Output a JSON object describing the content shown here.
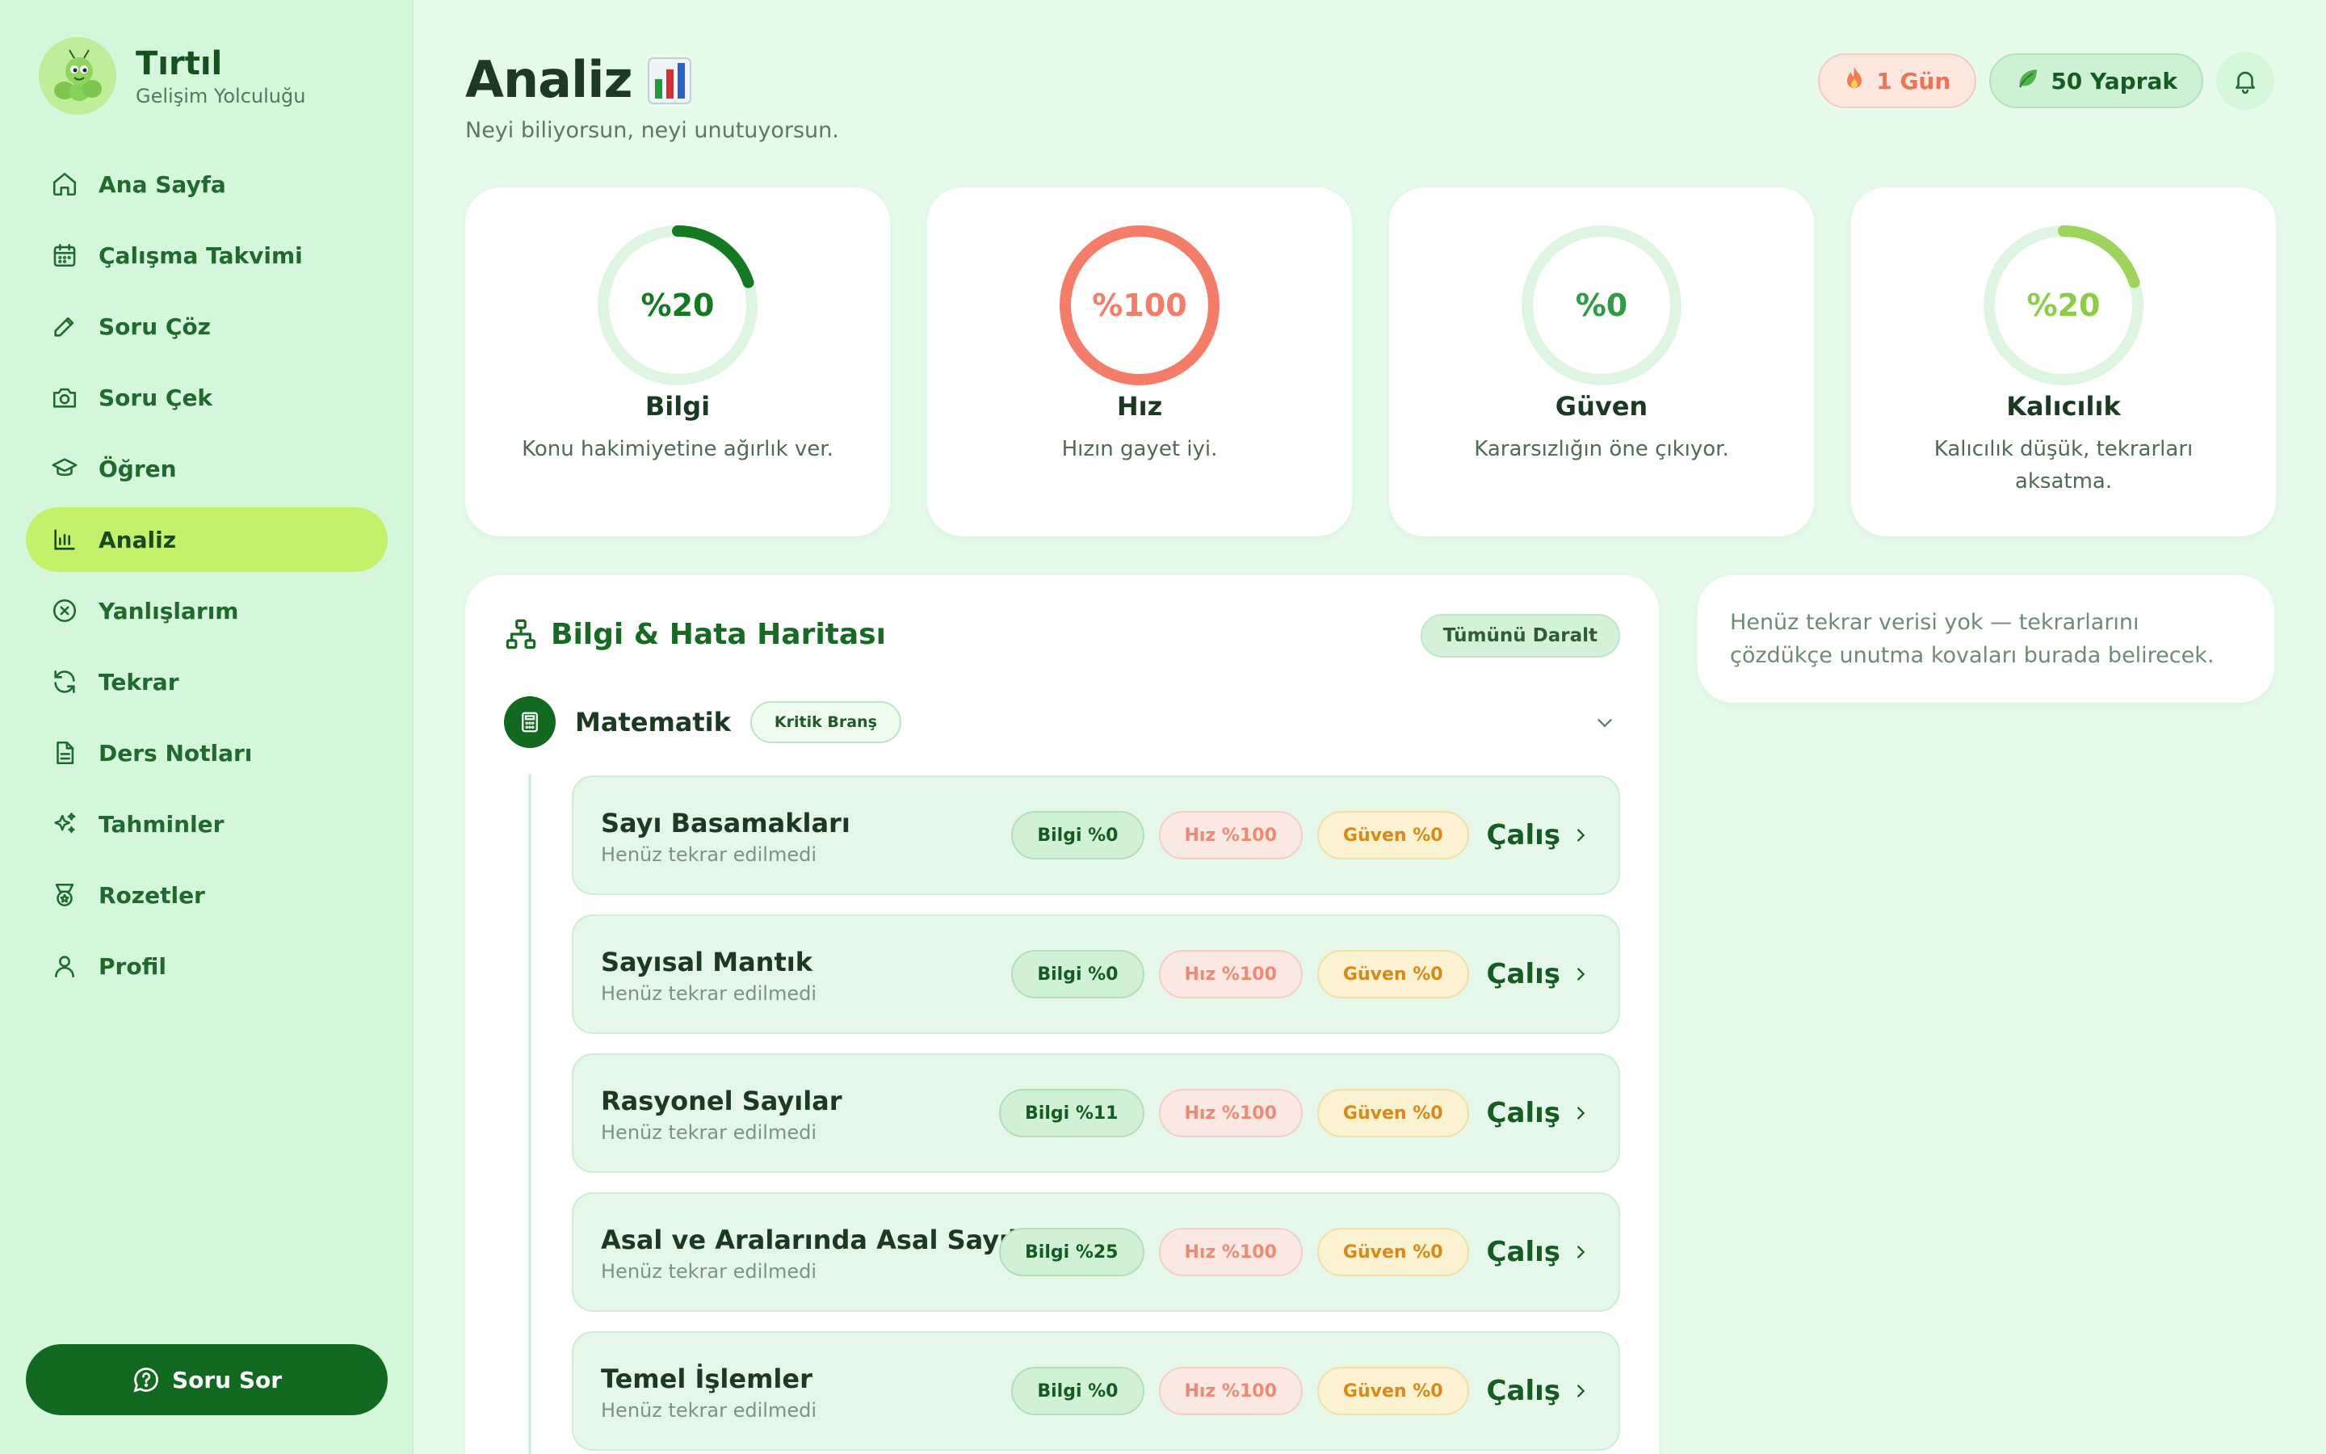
{
  "brand": {
    "title": "Tırtıl",
    "subtitle": "Gelişim Yolculuğu"
  },
  "sidebar": {
    "items": [
      {
        "label": "Ana Sayfa",
        "icon": "home-icon",
        "active": false
      },
      {
        "label": "Çalışma Takvimi",
        "icon": "calendar-icon",
        "active": false
      },
      {
        "label": "Soru Çöz",
        "icon": "pencil-icon",
        "active": false
      },
      {
        "label": "Soru Çek",
        "icon": "camera-icon",
        "active": false
      },
      {
        "label": "Öğren",
        "icon": "graduation-cap-icon",
        "active": false
      },
      {
        "label": "Analiz",
        "icon": "bar-chart-icon",
        "active": true
      },
      {
        "label": "Yanlışlarım",
        "icon": "x-circle-icon",
        "active": false
      },
      {
        "label": "Tekrar",
        "icon": "refresh-icon",
        "active": false
      },
      {
        "label": "Ders Notları",
        "icon": "document-icon",
        "active": false
      },
      {
        "label": "Tahminler",
        "icon": "sparkles-icon",
        "active": false
      },
      {
        "label": "Rozetler",
        "icon": "medal-icon",
        "active": false
      },
      {
        "label": "Profil",
        "icon": "user-icon",
        "active": false
      }
    ],
    "ask_button": "Soru Sor"
  },
  "header": {
    "title": "Analiz",
    "subtitle": "Neyi biliyorsun, neyi unutuyorsun.",
    "streak": "1 Gün",
    "leaves": "50 Yaprak"
  },
  "metrics": [
    {
      "value": "%20",
      "percent": 20,
      "name": "Bilgi",
      "desc": "Konu hakimiyetine ağırlık ver.",
      "color": "#137a22",
      "text_color": "#137a22"
    },
    {
      "value": "%100",
      "percent": 100,
      "name": "Hız",
      "desc": "Hızın gayet iyi.",
      "color": "#f47c69",
      "text_color": "#f47c69"
    },
    {
      "value": "%0",
      "percent": 0,
      "name": "Güven",
      "desc": "Kararsızlığın öne çıkıyor.",
      "color": "#2e9b45",
      "text_color": "#2e9b45"
    },
    {
      "value": "%20",
      "percent": 20,
      "name": "Kalıcılık",
      "desc": "Kalıcılık düşük, tekrarları aksatma.",
      "color": "#9ed35c",
      "text_color": "#8dcc46"
    }
  ],
  "knowledge_map": {
    "title": "Bilgi & Hata Haritası",
    "collapse_label": "Tümünü Daralt",
    "subject": {
      "name": "Matematik",
      "badge": "Kritik Branş"
    },
    "study_label": "Çalış",
    "topics": [
      {
        "name": "Sayı Basamakları",
        "sub": "Henüz tekrar edilmedi",
        "bilgi": "Bilgi %0",
        "hiz": "Hız %100",
        "guven": "Güven %0"
      },
      {
        "name": "Sayısal Mantık",
        "sub": "Henüz tekrar edilmedi",
        "bilgi": "Bilgi %0",
        "hiz": "Hız %100",
        "guven": "Güven %0"
      },
      {
        "name": "Rasyonel Sayılar",
        "sub": "Henüz tekrar edilmedi",
        "bilgi": "Bilgi %11",
        "hiz": "Hız %100",
        "guven": "Güven %0"
      },
      {
        "name": "Asal ve Aralarında Asal Sayılar",
        "sub": "Henüz tekrar edilmedi",
        "bilgi": "Bilgi %25",
        "hiz": "Hız %100",
        "guven": "Güven %0"
      },
      {
        "name": "Temel İşlemler",
        "sub": "Henüz tekrar edilmedi",
        "bilgi": "Bilgi %0",
        "hiz": "Hız %100",
        "guven": "Güven %0"
      }
    ]
  },
  "repeat_info": "Henüz tekrar verisi yok — tekrarlarını çözdükçe unutma kovaları burada belirecek."
}
